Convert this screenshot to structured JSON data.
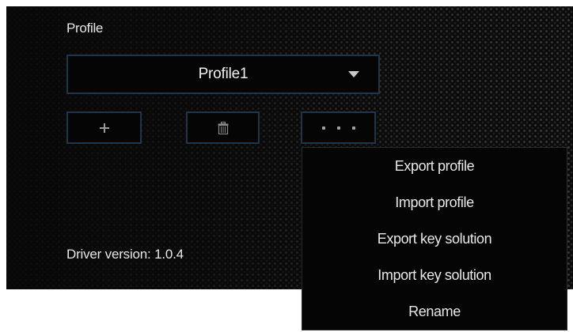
{
  "profile": {
    "label": "Profile",
    "selected": "Profile1"
  },
  "buttons": {
    "add_icon": "plus-icon",
    "delete_icon": "trash-icon",
    "more_icon": "more-dots-icon"
  },
  "more_menu": {
    "items": [
      "Export profile",
      "Import profile",
      "Export key solution",
      "Import key solution",
      "Rename"
    ]
  },
  "driver_version": "Driver version:  1.0.4",
  "colors": {
    "panel_bg": "#0c0c0c",
    "border_accent": "#20354a",
    "text": "#e6e6e6"
  }
}
